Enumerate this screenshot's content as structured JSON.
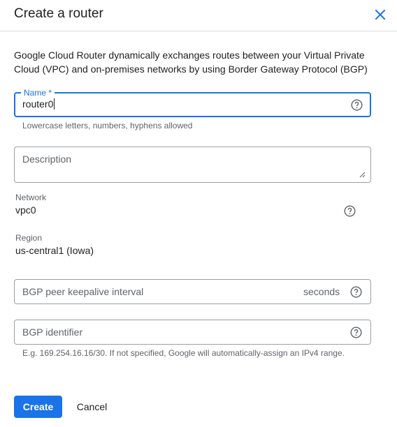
{
  "dialog": {
    "title": "Create a router",
    "close_icon": "close-icon"
  },
  "intro": "Google Cloud Router dynamically exchanges routes between your Virtual Private Cloud (VPC) and on-premises networks by using Border Gateway Protocol (BGP)",
  "name_field": {
    "label": "Name *",
    "value": "router0",
    "hint": "Lowercase letters, numbers, hyphens allowed",
    "help_icon": "help-icon"
  },
  "description_field": {
    "placeholder": "Description",
    "value": ""
  },
  "network": {
    "label": "Network",
    "value": "vpc0",
    "help_icon": "help-icon"
  },
  "region": {
    "label": "Region",
    "value": "us-central1 (Iowa)"
  },
  "keepalive_field": {
    "placeholder": "BGP peer keepalive interval",
    "suffix": "seconds",
    "help_icon": "help-icon"
  },
  "bgp_identifier_field": {
    "placeholder": "BGP identifier",
    "hint": "E.g. 169.254.16.16/30. If not specified, Google will automatically-assign an IPv4 range.",
    "help_icon": "help-icon"
  },
  "actions": {
    "create_label": "Create",
    "cancel_label": "Cancel"
  },
  "colors": {
    "primary": "#1a73e8",
    "text": "#202124",
    "secondary_text": "#5f6368",
    "border": "#9aa0a6"
  }
}
